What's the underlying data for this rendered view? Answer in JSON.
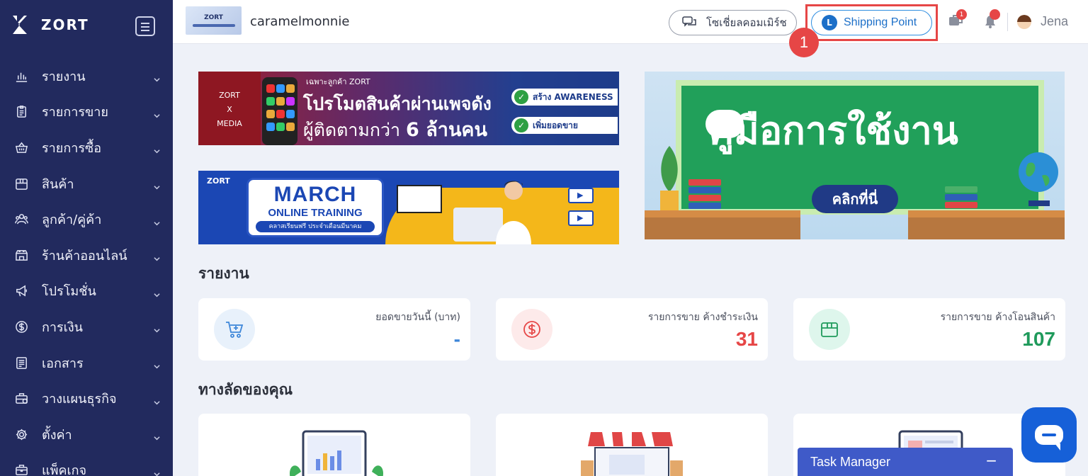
{
  "brand": {
    "name": "ZORT"
  },
  "sidebar": {
    "items": [
      {
        "label": "รายงาน",
        "icon": "bar-chart-icon"
      },
      {
        "label": "รายการขาย",
        "icon": "clipboard-icon"
      },
      {
        "label": "รายการซื้อ",
        "icon": "basket-icon"
      },
      {
        "label": "สินค้า",
        "icon": "box-icon"
      },
      {
        "label": "ลูกค้า/คู่ค้า",
        "icon": "users-icon"
      },
      {
        "label": "ร้านค้าออนไลน์",
        "icon": "store-icon"
      },
      {
        "label": "โปรโมชั่น",
        "icon": "megaphone-icon"
      },
      {
        "label": "การเงิน",
        "icon": "dollar-icon"
      },
      {
        "label": "เอกสาร",
        "icon": "document-icon"
      },
      {
        "label": "วางแผนธุรกิจ",
        "icon": "briefcase-icon"
      },
      {
        "label": "ตั้งค่า",
        "icon": "gear-icon"
      },
      {
        "label": "แพ็คเกจ",
        "icon": "package-icon"
      }
    ]
  },
  "header": {
    "shop_name": "caramelmonnie",
    "shop_logo_text": "ZORT",
    "social_label": "โซเชี่ยลคอมเมิร์ช",
    "shipping_label": "Shipping Point",
    "shipping_icon_letter": "L",
    "step_number": "1",
    "chat_badge": "1",
    "user_name": "Jena"
  },
  "banners": {
    "media": {
      "small": "เฉพาะลูกค้า ZORT",
      "left_line1": "ZORT",
      "left_line2": "X",
      "left_line3": "MEDIA",
      "line1": "โปรโมตสินค้าผ่านเพจดัง",
      "line2_prefix": "ผู้ติดตามกว่า",
      "line2_bold": "6 ล้านคน",
      "tag1": "สร้าง AWARENESS",
      "tag2": "เพิ่มยอดขาย"
    },
    "march": {
      "zort": "ZORT",
      "title": "MARCH",
      "subtitle": "ONLINE TRAINING",
      "caption": "คลาสเรียนฟรี ประจำเดือนมีนาคม"
    },
    "manual": {
      "title": "คู่มือการใช้งาน",
      "button": "คลิกที่นี่"
    }
  },
  "reports": {
    "title": "รายงาน",
    "cards": [
      {
        "label": "ยอดขายวันนี้ (บาท)",
        "value": "-",
        "color": "#3d86d9",
        "icon": "cart-plus-icon"
      },
      {
        "label": "รายการขาย ค้างชำระเงิน",
        "value": "31",
        "color": "#e64646",
        "icon": "dollar-circle-icon"
      },
      {
        "label": "รายการขาย ค้างโอนสินค้า",
        "value": "107",
        "color": "#1f9a5b",
        "icon": "box-icon"
      }
    ]
  },
  "shortcuts": {
    "title": "ทางลัดของคุณ"
  },
  "task_manager": {
    "label": "Task Manager",
    "minimize": "−"
  }
}
